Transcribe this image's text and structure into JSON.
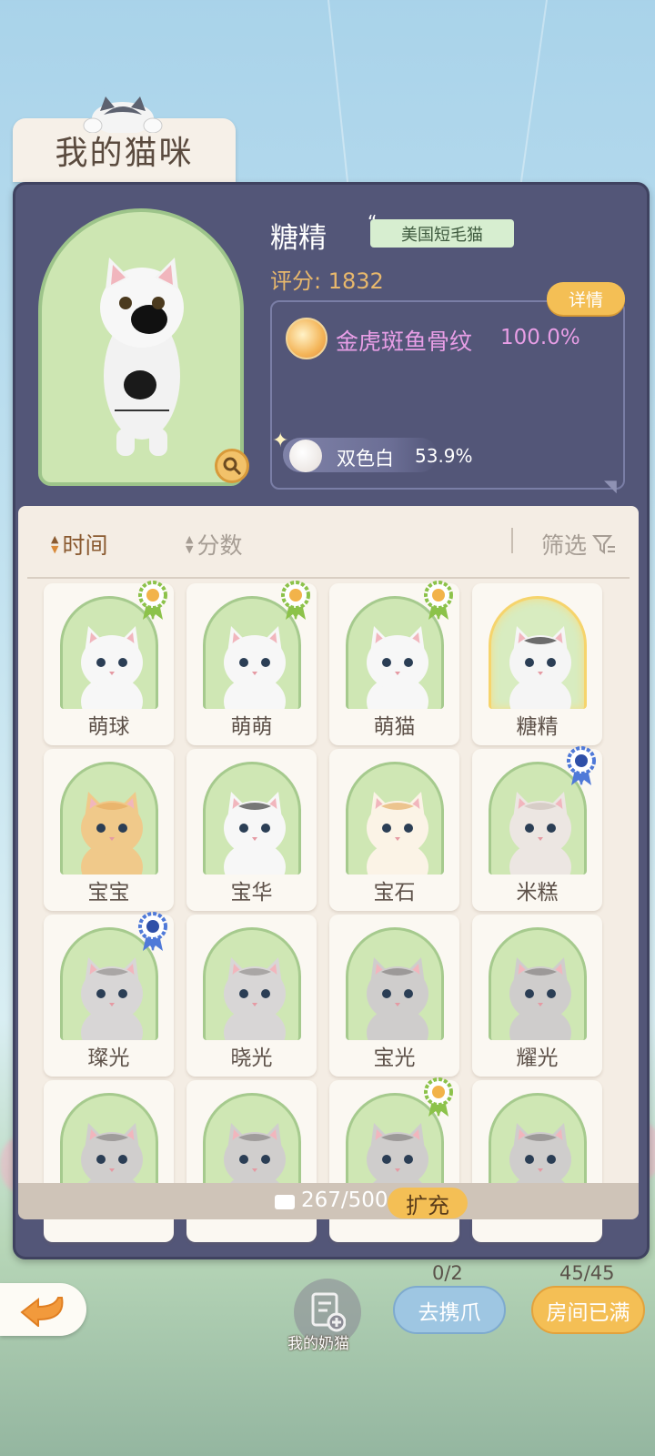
{
  "header": {
    "title": "我的猫咪"
  },
  "selected_cat": {
    "name": "糖精",
    "breed": "美国短毛猫",
    "score_label": "评分: 1832",
    "detail_button": "详情",
    "genes": [
      {
        "label": "金虎斑鱼骨纹",
        "percent": "100.0%"
      },
      {
        "label": "双色白",
        "percent": "53.9%"
      }
    ]
  },
  "sort_bar": {
    "time_label": "时间",
    "score_label": "分数",
    "filter_label": "筛选"
  },
  "cats": [
    {
      "name": "萌球",
      "medal": "green"
    },
    {
      "name": "萌萌",
      "medal": "green"
    },
    {
      "name": "萌猫",
      "medal": "green"
    },
    {
      "name": "糖精",
      "medal": "",
      "selected": true
    },
    {
      "name": "宝宝",
      "medal": ""
    },
    {
      "name": "宝华",
      "medal": ""
    },
    {
      "name": "宝石",
      "medal": ""
    },
    {
      "name": "米糕",
      "medal": "blue"
    },
    {
      "name": "璨光",
      "medal": "blue"
    },
    {
      "name": "晓光",
      "medal": ""
    },
    {
      "name": "宝光",
      "medal": ""
    },
    {
      "name": "耀光",
      "medal": ""
    },
    {
      "name": "",
      "medal": ""
    },
    {
      "name": "",
      "medal": ""
    },
    {
      "name": "",
      "medal": "green"
    },
    {
      "name": "",
      "medal": ""
    }
  ],
  "storage": {
    "count": "267/500",
    "expand_label": "扩充"
  },
  "bottom": {
    "milk_cat_label": "我的奶猫",
    "claw_count": "0/2",
    "claw_button": "去携爪",
    "room_count": "45/45",
    "room_button": "房间已满"
  },
  "colors": {
    "panel": "#535678",
    "accent_orange": "#f4bf55",
    "gene_pink": "#e89ee6",
    "score_gold": "#e8b86c"
  }
}
